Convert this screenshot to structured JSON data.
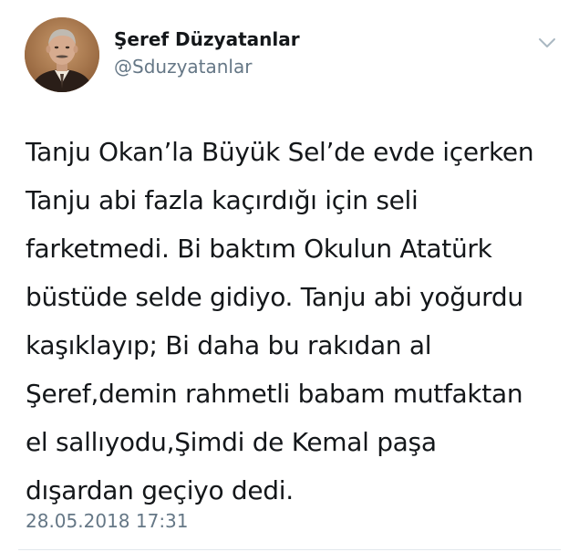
{
  "tweet": {
    "author": {
      "display_name": "Şeref Düzyatanlar",
      "handle": "@Sduzyatanlar"
    },
    "text_lines": [
      "Tanju Okan’la Büyük Sel’de evde içerken",
      "Tanju abi fazla kaçırdığı için seli",
      "farketmedi. Bi baktım Okulun Atatürk",
      "büstüde selde gidiyo. Tanju abi yoğurdu",
      "kaşıklayıp; Bi daha bu rakıdan al",
      "Şeref,demin rahmetli babam mutfaktan",
      "el sallıyodu,Şimdi de Kemal paşa",
      "dışardan geçiyo dedi."
    ],
    "timestamp": "28.05.2018 17:31"
  },
  "icons": {
    "avatar": "profile-photo",
    "caret": "chevron-down-icon"
  },
  "colors": {
    "text_primary": "#14171a",
    "text_secondary": "#657786",
    "divider": "#e1e8ed",
    "caret": "#aab8c2"
  }
}
